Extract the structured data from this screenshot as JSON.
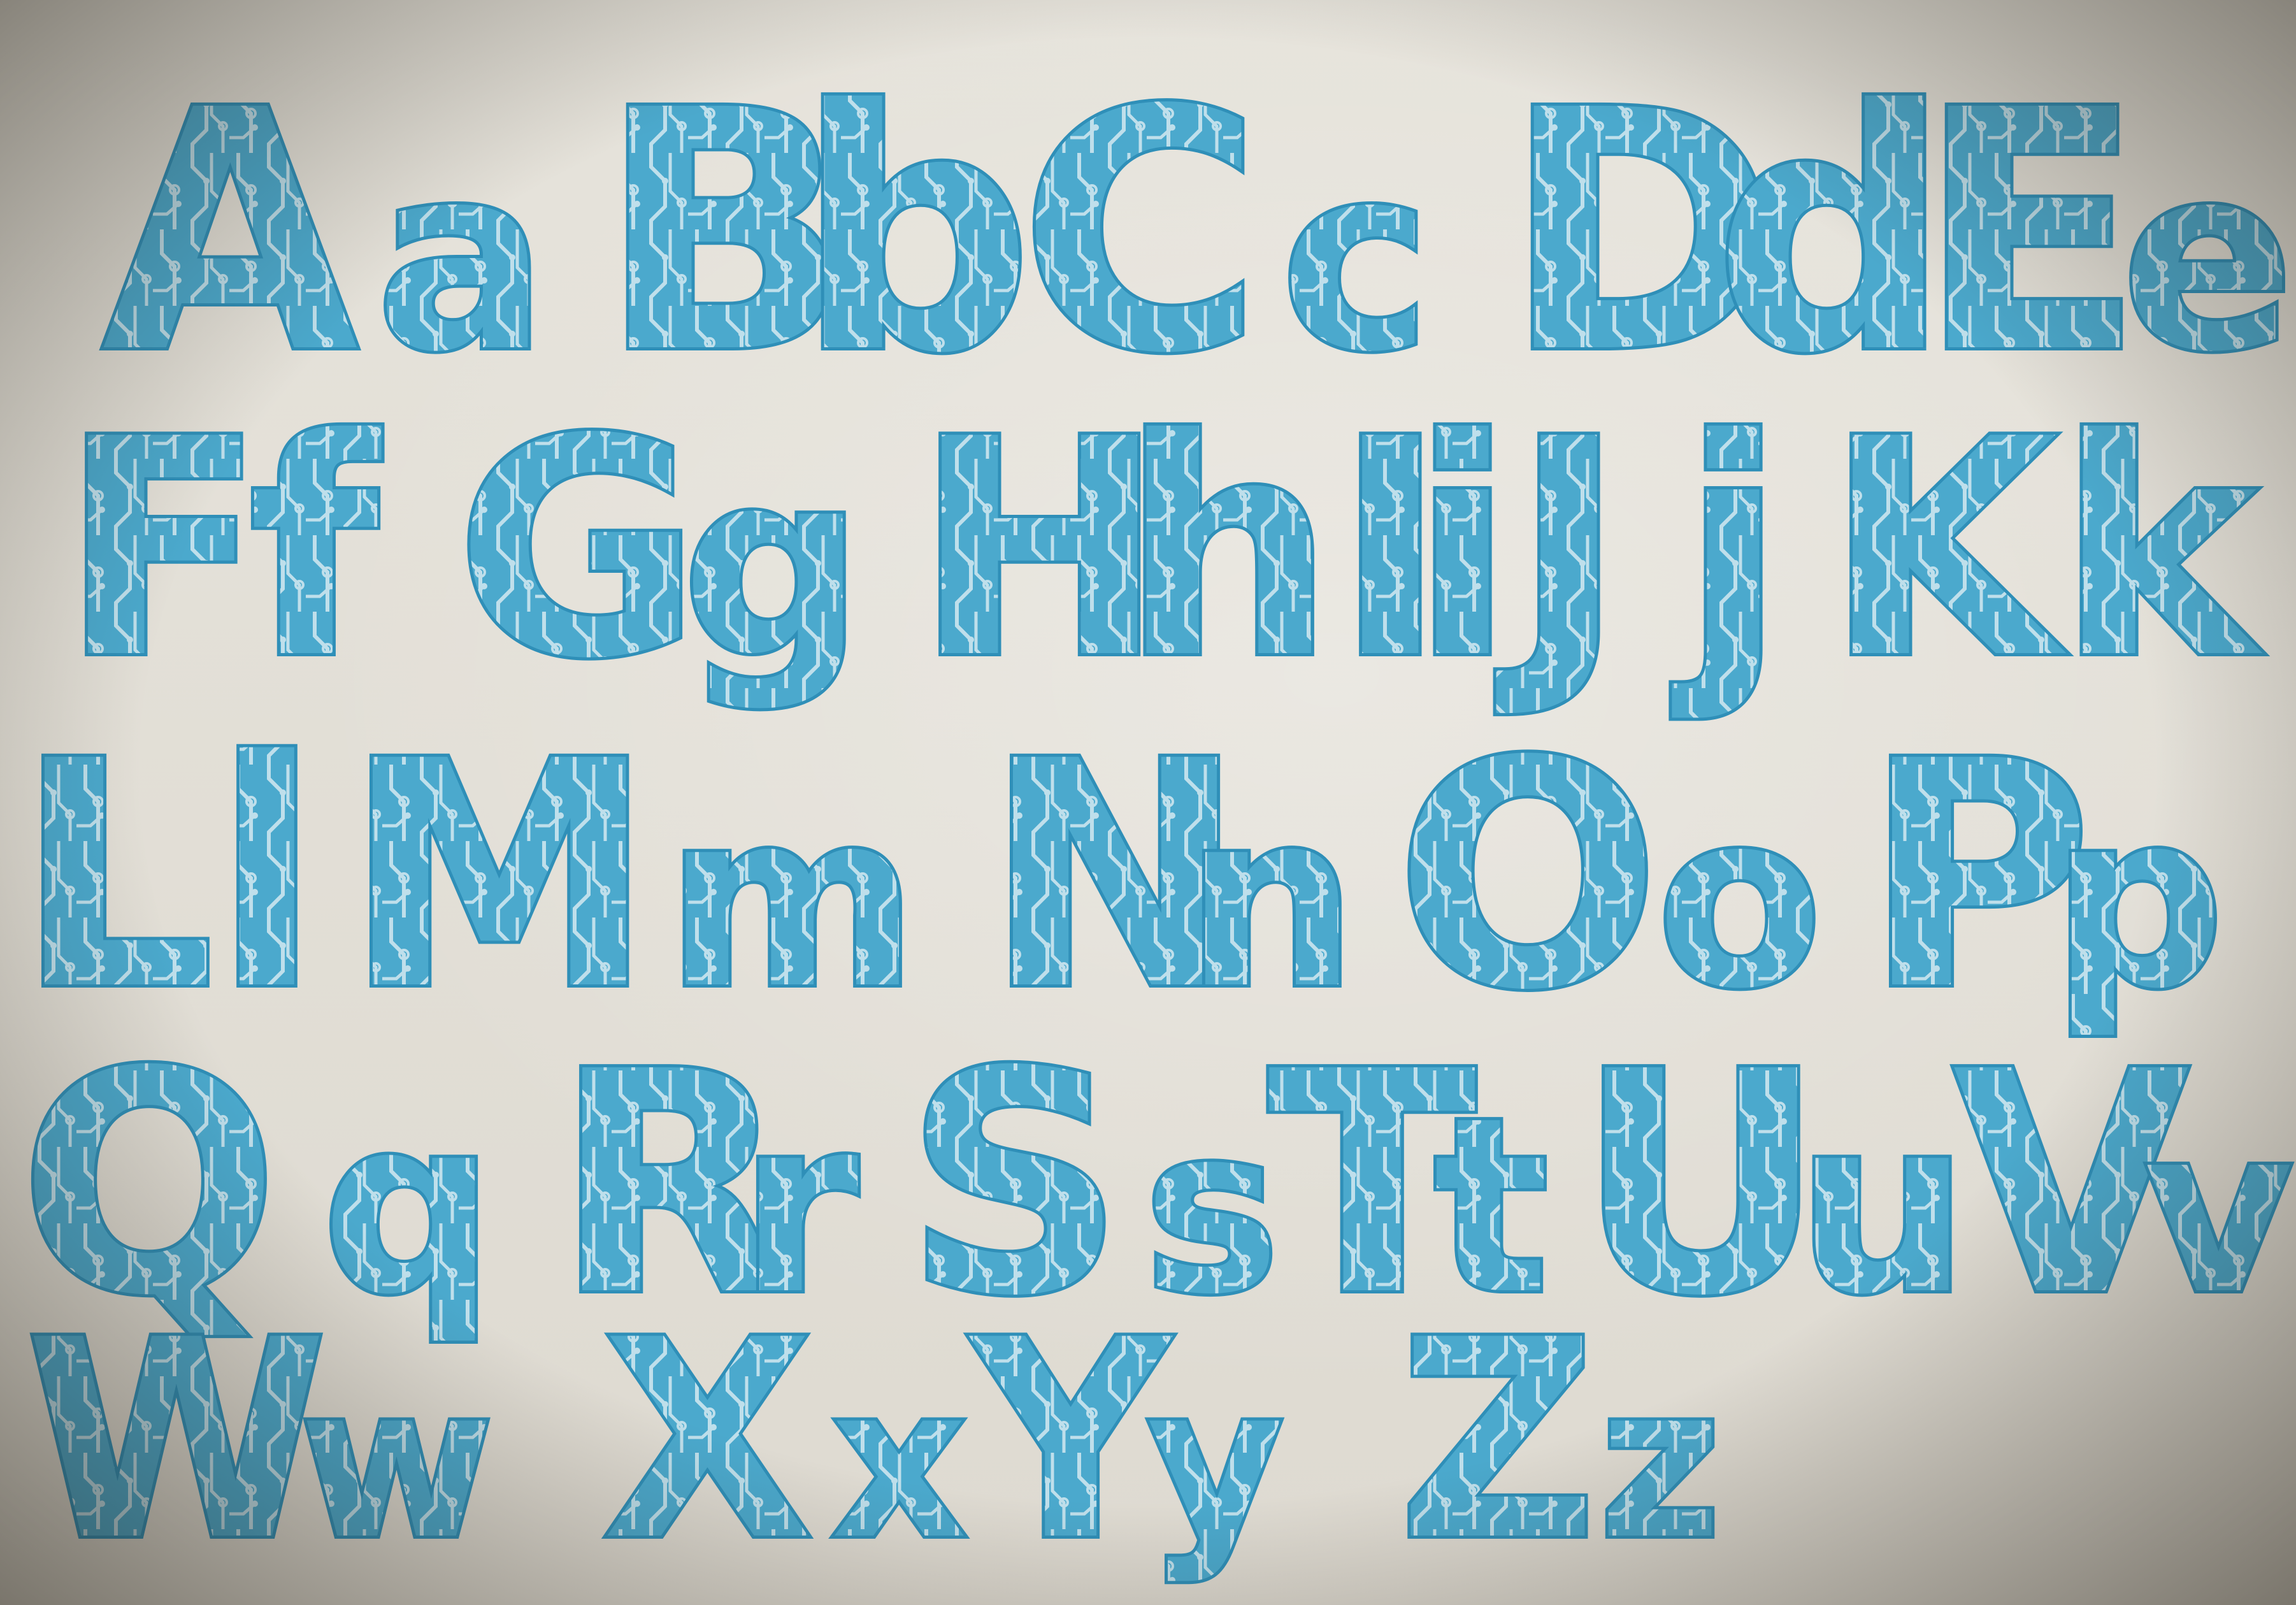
{
  "artwork": {
    "rows": [
      {
        "glyphs": [
          "A",
          "a",
          "B",
          "b",
          "C",
          "c",
          "D",
          "d",
          "E",
          "e"
        ]
      },
      {
        "glyphs": [
          "F",
          "f",
          "G",
          "g",
          "H",
          "h",
          "I",
          "i",
          "J",
          "j",
          "K",
          "k"
        ]
      },
      {
        "glyphs": [
          "L",
          "l",
          "M",
          "m",
          "N",
          "n",
          "O",
          "o",
          "P",
          "p"
        ]
      },
      {
        "glyphs": [
          "Q",
          "q",
          "R",
          "r",
          "S",
          "s",
          "T",
          "t",
          "U",
          "u",
          "V",
          "v"
        ]
      },
      {
        "glyphs": [
          "W",
          "w",
          "X",
          "x",
          "Y",
          "y",
          "Z",
          "z"
        ]
      }
    ]
  },
  "colors": {
    "paper": "#e3e0d8",
    "ink": "#4ba9cd",
    "ink_edge": "#2f8fb8",
    "circuit_trace": "#e6f2f6"
  },
  "style": {
    "motif": "circuit-board traces",
    "medium": "hand-painted"
  }
}
